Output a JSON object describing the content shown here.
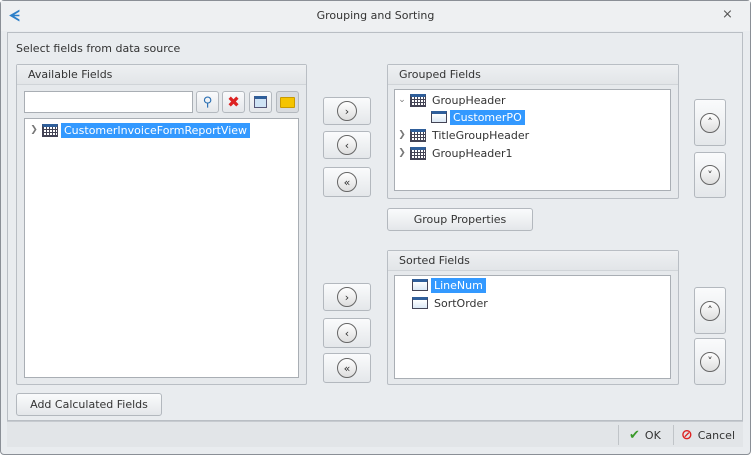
{
  "window": {
    "title": "Grouping and Sorting",
    "close_label": "⨯"
  },
  "instruction": "Select fields from data source",
  "available": {
    "header": "Available Fields",
    "search_value": "",
    "search_placeholder": "",
    "tree": [
      {
        "label": "CustomerInvoiceFormReportView",
        "selected": true,
        "expanded": false
      }
    ]
  },
  "grouped": {
    "header": "Grouped Fields",
    "tree": [
      {
        "label": "GroupHeader",
        "expanded": true
      },
      {
        "label": "CustomerPO",
        "selected": true
      },
      {
        "label": "TitleGroupHeader",
        "expanded": false
      },
      {
        "label": "GroupHeader1",
        "expanded": false
      }
    ]
  },
  "group_properties_label": "Group Properties",
  "sorted": {
    "header": "Sorted Fields",
    "tree": [
      {
        "label": "LineNum",
        "selected": true
      },
      {
        "label": "SortOrder"
      }
    ]
  },
  "add_calculated_label": "Add Calculated Fields",
  "arrows": {
    "add": "›",
    "remove": "‹",
    "remove_all": "«",
    "up": "˄",
    "down": "˅"
  },
  "footer": {
    "ok": "OK",
    "cancel": "Cancel"
  },
  "colors": {
    "selection": "#3399ff",
    "accent": "#2b7fc9"
  }
}
